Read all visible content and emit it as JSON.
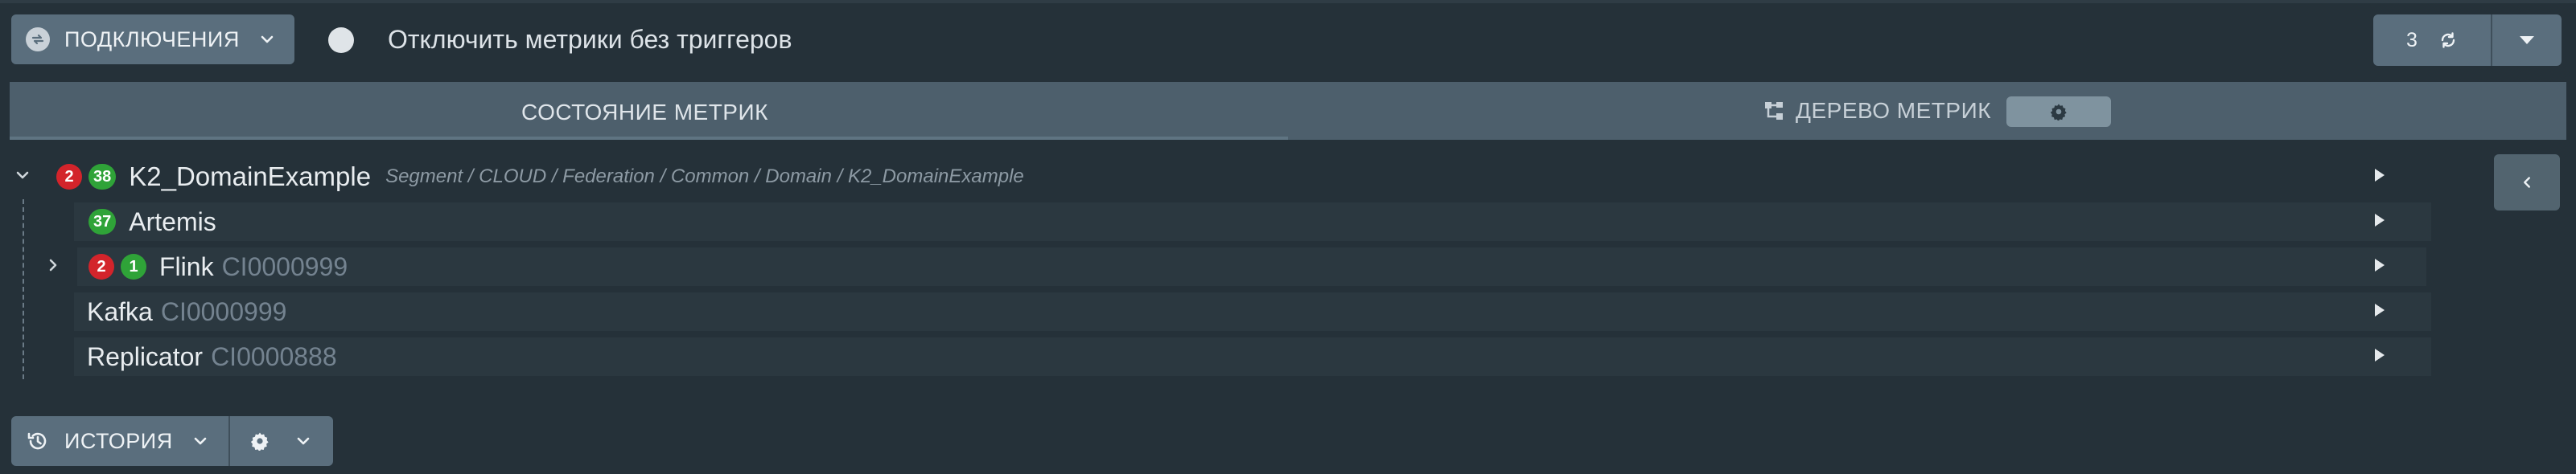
{
  "toolbar": {
    "connections_label": "ПОДКЛЮЧЕНИЯ",
    "toggle_label": "Отключить метрики без триггеров",
    "refresh_count": "3"
  },
  "tabs": {
    "state_label": "СОСТОЯНИЕ МЕТРИК",
    "tree_label": "ДЕРЕВО МЕТРИК"
  },
  "tree": {
    "root": {
      "name": "K2_DomainExample",
      "path": "Segment / CLOUD / Federation / Common / Domain / K2_DomainExample",
      "badge_red": "2",
      "badge_green": "38"
    },
    "children": [
      {
        "name": "Artemis",
        "badge_green": "37"
      },
      {
        "name": "Flink",
        "ci": "CI0000999",
        "badge_red": "2",
        "badge_green": "1"
      },
      {
        "name": "Kafka",
        "ci": "CI0000999"
      },
      {
        "name": "Replicator",
        "ci": "CI0000888"
      }
    ]
  },
  "bottom": {
    "history_label": "ИСТОРИЯ"
  },
  "colors": {
    "background": "#253139",
    "button": "#5a6e7d",
    "badge_red": "#d3242b",
    "badge_green": "#2fa338"
  }
}
